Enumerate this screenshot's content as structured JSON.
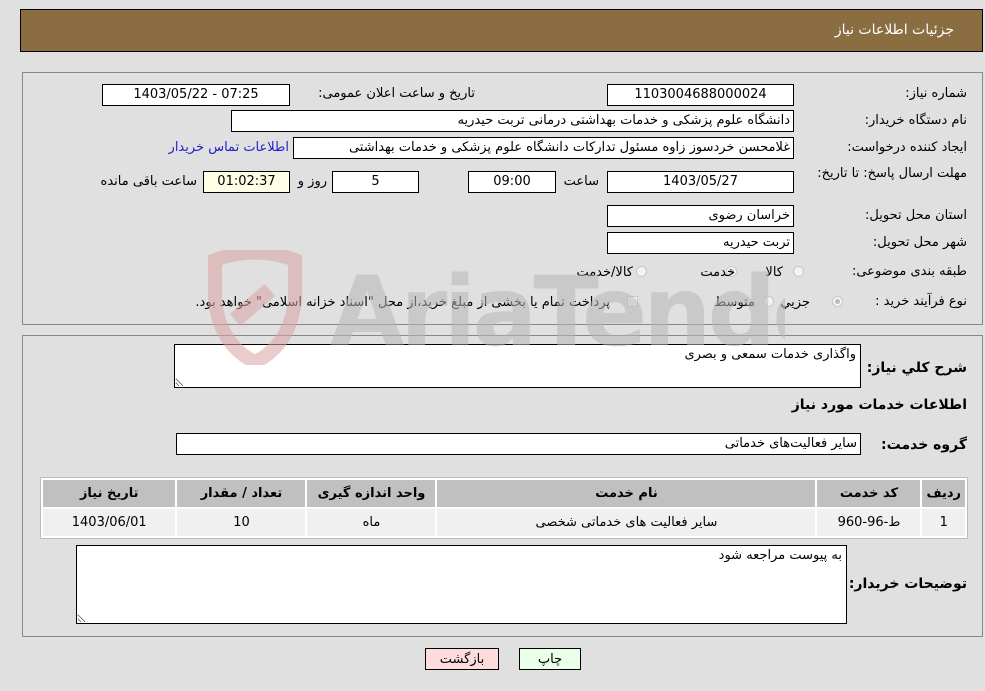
{
  "header": {
    "title": "جزئیات اطلاعات نیاز"
  },
  "fields": {
    "need_number": {
      "label": "شماره نیاز:",
      "value": "1103004688000024"
    },
    "announce_datetime": {
      "label": "تاریخ و ساعت اعلان عمومی:",
      "value": "1403/05/22 - 07:25"
    },
    "buyer_org": {
      "label": "نام دستگاه خریدار:",
      "value": "دانشگاه علوم پزشکی و خدمات بهداشتی درمانی تربت حیدریه"
    },
    "requester": {
      "label": "ایجاد کننده درخواست:",
      "value": "غلامحسن خردسوز زاوه مسئول تدارکات دانشگاه علوم پزشکی و خدمات بهداشتی"
    },
    "buyer_contact_link": "اطلاعات تماس خریدار",
    "deadline": {
      "label": "مهلت ارسال پاسخ: تا تاریخ:",
      "date": "1403/05/27",
      "time_label": "ساعت",
      "time": "09:00",
      "days": "5",
      "days_label": "روز و",
      "remaining": "01:02:37",
      "remaining_label": "ساعت باقی مانده"
    },
    "province": {
      "label": "استان محل تحویل:",
      "value": "خراسان رضوی"
    },
    "city": {
      "label": "شهر محل تحویل:",
      "value": "تربت حیدریه"
    },
    "category": {
      "label": "طبقه بندی موضوعی:",
      "options": [
        "کالا",
        "خدمت",
        "کالا/خدمت"
      ],
      "selected": "خدمت"
    },
    "purchase_process": {
      "label": "نوع فرآیند خرید :",
      "options": [
        "جزيي",
        "متوسط"
      ],
      "selected": "جزيي",
      "treasury_note": "پرداخت تمام یا بخشی از مبلغ خرید،از محل \"اسناد خزانه اسلامی\" خواهد بود."
    }
  },
  "description": {
    "label": "شرح کلي نياز:",
    "value": "واگذاری خدمات سمعی و بصری"
  },
  "services_section_title": "اطلاعات خدمات مورد نیاز",
  "service_group": {
    "label": "گروه خدمت:",
    "value": "سایر فعالیت‌های خدماتی"
  },
  "table": {
    "headers": [
      "ردیف",
      "کد خدمت",
      "نام خدمت",
      "واحد اندازه گیری",
      "تعداد / مقدار",
      "تاریخ نیاز"
    ],
    "rows": [
      [
        "1",
        "ط-96-960",
        "سایر فعالیت های خدماتی شخصی",
        "ماه",
        "10",
        "1403/06/01"
      ]
    ]
  },
  "buyer_notes": {
    "label": "توضیحات خریدار:",
    "value": "به پیوست مراجعه شود"
  },
  "buttons": {
    "back": "بازگشت",
    "print": "چاپ"
  },
  "watermark": {
    "text": "AriaTender.neT",
    "color": "#d9a0a0"
  },
  "colors": {
    "header_bg": "#8b6d42",
    "link": "#2222cc",
    "back_btn": "#ffdcdc",
    "print_btn": "#eaffea"
  }
}
